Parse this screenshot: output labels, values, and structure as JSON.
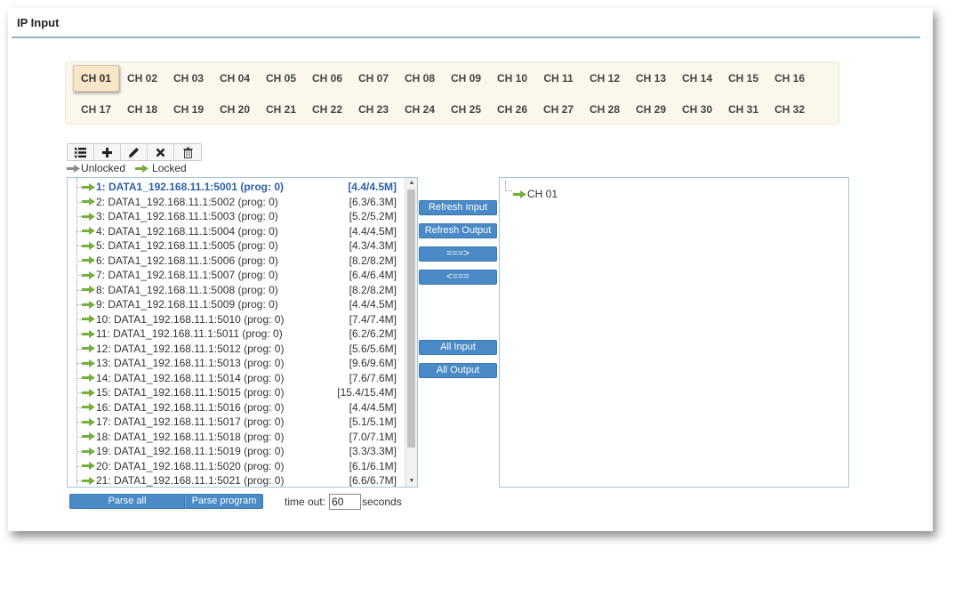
{
  "page": {
    "title": "IP Input"
  },
  "channels": {
    "active": "CH 01",
    "row1": [
      "CH 01",
      "CH 02",
      "CH 03",
      "CH 04",
      "CH 05",
      "CH 06",
      "CH 07",
      "CH 08",
      "CH 09",
      "CH 10",
      "CH 11",
      "CH 12",
      "CH 13",
      "CH 14",
      "CH 15",
      "CH 16"
    ],
    "row2": [
      "CH 17",
      "CH 18",
      "CH 19",
      "CH 20",
      "CH 21",
      "CH 22",
      "CH 23",
      "CH 24",
      "CH 25",
      "CH 26",
      "CH 27",
      "CH 28",
      "CH 29",
      "CH 30",
      "CH 31",
      "CH 32"
    ]
  },
  "toolbar": {
    "buttons": [
      {
        "name": "list-button",
        "icon": "list-icon"
      },
      {
        "name": "add-button",
        "icon": "plus-icon"
      },
      {
        "name": "edit-button",
        "icon": "pencil-icon"
      },
      {
        "name": "remove-button",
        "icon": "x-icon"
      },
      {
        "name": "delete-button",
        "icon": "trash-icon"
      }
    ]
  },
  "legend": {
    "unlocked": "Unlocked",
    "locked": "Locked"
  },
  "colors": {
    "unlocked_arrow": "#8c8c8c",
    "locked_arrow": "#74ae3c",
    "button_blue": "#4a8ac6",
    "selected_text": "#2b62a6"
  },
  "inputs": [
    {
      "label": "1: DATA1_192.168.11.1:5001 (prog: 0)",
      "rate": "[4.4/4.5M]",
      "selected": true
    },
    {
      "label": "2: DATA1_192.168.11.1:5002 (prog: 0)",
      "rate": "[6.3/6.3M]"
    },
    {
      "label": "3: DATA1_192.168.11.1:5003 (prog: 0)",
      "rate": "[5.2/5.2M]"
    },
    {
      "label": "4: DATA1_192.168.11.1:5004 (prog: 0)",
      "rate": "[4.4/4.5M]"
    },
    {
      "label": "5: DATA1_192.168.11.1:5005 (prog: 0)",
      "rate": "[4.3/4.3M]"
    },
    {
      "label": "6: DATA1_192.168.11.1:5006 (prog: 0)",
      "rate": "[8.2/8.2M]"
    },
    {
      "label": "7: DATA1_192.168.11.1:5007 (prog: 0)",
      "rate": "[6.4/6.4M]"
    },
    {
      "label": "8: DATA1_192.168.11.1:5008 (prog: 0)",
      "rate": "[8.2/8.2M]"
    },
    {
      "label": "9: DATA1_192.168.11.1:5009 (prog: 0)",
      "rate": "[4.4/4.5M]"
    },
    {
      "label": "10: DATA1_192.168.11.1:5010 (prog: 0)",
      "rate": "[7.4/7.4M]"
    },
    {
      "label": "11: DATA1_192.168.11.1:5011 (prog: 0)",
      "rate": "[6.2/6.2M]"
    },
    {
      "label": "12: DATA1_192.168.11.1:5012 (prog: 0)",
      "rate": "[5.6/5.6M]"
    },
    {
      "label": "13: DATA1_192.168.11.1:5013 (prog: 0)",
      "rate": "[9.6/9.6M]"
    },
    {
      "label": "14: DATA1_192.168.11.1:5014 (prog: 0)",
      "rate": "[7.6/7.6M]"
    },
    {
      "label": "15: DATA1_192.168.11.1:5015 (prog: 0)",
      "rate": "[15.4/15.4M]"
    },
    {
      "label": "16: DATA1_192.168.11.1:5016 (prog: 0)",
      "rate": "[4.4/4.5M]"
    },
    {
      "label": "17: DATA1_192.168.11.1:5017 (prog: 0)",
      "rate": "[5.1/5.1M]"
    },
    {
      "label": "18: DATA1_192.168.11.1:5018 (prog: 0)",
      "rate": "[7.0/7.1M]"
    },
    {
      "label": "19: DATA1_192.168.11.1:5019 (prog: 0)",
      "rate": "[3.3/3.3M]"
    },
    {
      "label": "20: DATA1_192.168.11.1:5020 (prog: 0)",
      "rate": "[6.1/6.1M]"
    },
    {
      "label": "21: DATA1_192.168.11.1:5021 (prog: 0)",
      "rate": "[6.6/6.7M]"
    }
  ],
  "actions": {
    "refresh_input": "Refresh Input",
    "refresh_output": "Refresh Output",
    "move_right": "===>",
    "move_left": "<===",
    "all_input": "All Input",
    "all_output": "All Output"
  },
  "output": {
    "node": "CH 01"
  },
  "bottom": {
    "parse_all": "Parse all",
    "parse_program": "Parse program",
    "timeout_label": "time out:",
    "timeout_value": "60",
    "seconds_label": "seconds"
  }
}
